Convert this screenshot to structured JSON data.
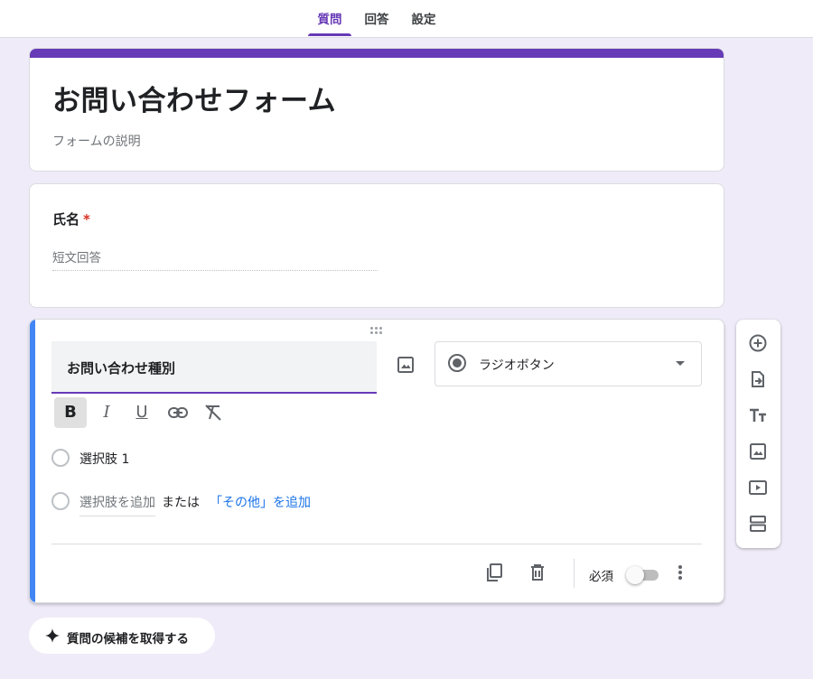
{
  "tabs": [
    {
      "label": "質問",
      "active": true
    },
    {
      "label": "回答",
      "active": false
    },
    {
      "label": "設定",
      "active": false
    }
  ],
  "form": {
    "title": "お問い合わせフォーム",
    "description": "フォームの説明",
    "accent_color": "#673ab7"
  },
  "name_question": {
    "title": "氏名",
    "required_mark": "*",
    "placeholder": "短文回答"
  },
  "active_question": {
    "title": "お問い合わせ種別",
    "type_label": "ラジオボタン",
    "options": [
      {
        "label": "選択肢 1"
      }
    ],
    "add_option_label": "選択肢を追加",
    "or_label": "または",
    "add_other_label": "「その他」を追加",
    "required_label": "必須",
    "required_enabled": false,
    "format_buttons": [
      "B",
      "I",
      "U",
      "link",
      "clear-format"
    ]
  },
  "toolbar_icons": [
    "add-question-icon",
    "import-questions-icon",
    "title-text-icon",
    "add-image-icon",
    "add-video-icon",
    "add-section-icon"
  ],
  "suggest_button": {
    "label": "質問の候補を取得する",
    "icon": "sparkle-icon"
  }
}
